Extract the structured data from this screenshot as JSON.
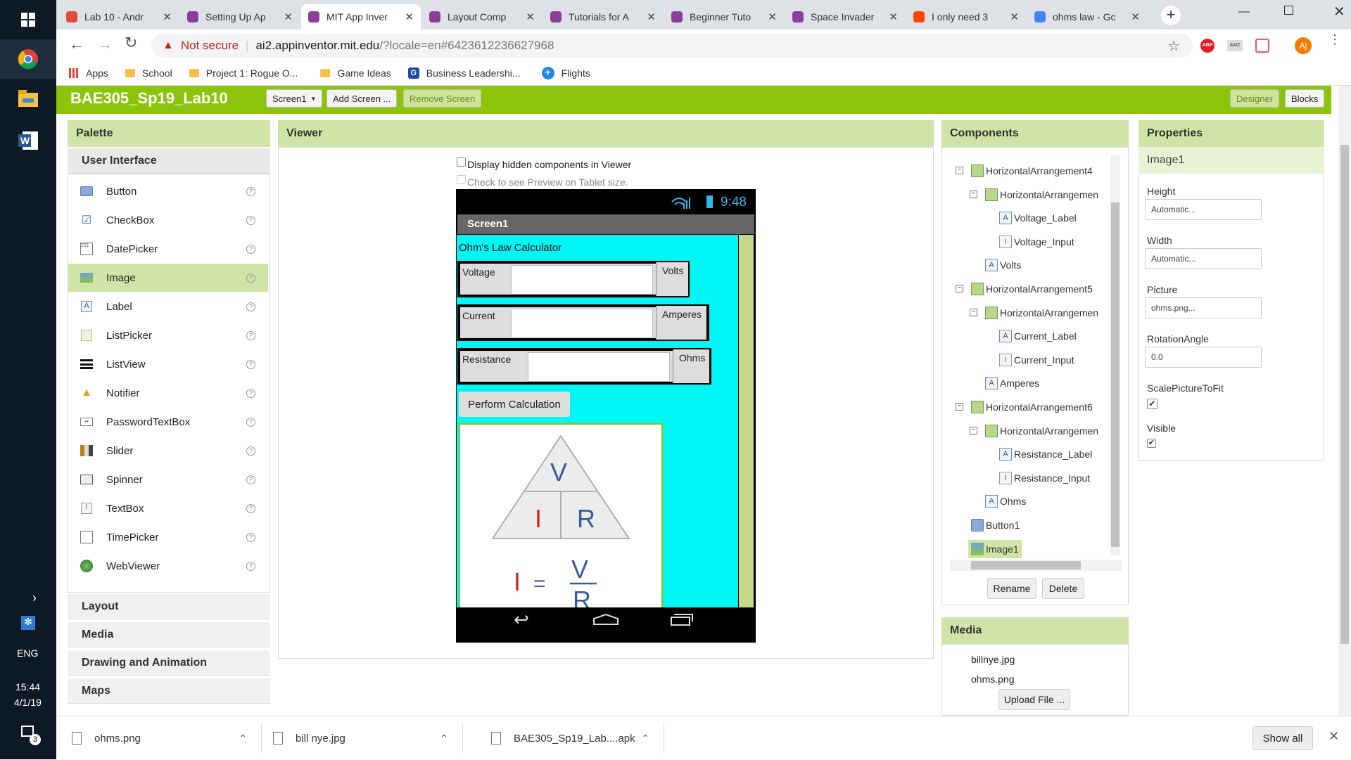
{
  "taskbar": {
    "lang": "ENG",
    "time": "15:44",
    "date": "4/1/19",
    "notif_count": "3"
  },
  "browser": {
    "tabs": [
      {
        "title": "Lab 10 - Andr",
        "color": "#e34a3a"
      },
      {
        "title": "Setting Up Ap",
        "color": "#8c3f9a"
      },
      {
        "title": "MIT App Inver",
        "color": "#8c3f9a",
        "active": true
      },
      {
        "title": "Layout Comp",
        "color": "#8c3f9a"
      },
      {
        "title": "Tutorials for A",
        "color": "#8c3f9a"
      },
      {
        "title": "Beginner Tuto",
        "color": "#8c3f9a"
      },
      {
        "title": "Space Invader",
        "color": "#8c3f9a"
      },
      {
        "title": "I only need 3",
        "color": "#ff4500"
      },
      {
        "title": "ohms law - Gc",
        "color": "#4285f4"
      }
    ],
    "security": "Not secure",
    "url_host": "ai2.appinventor.mit.edu",
    "url_rest": "/?locale=en#6423612236627968",
    "profile": "Aj",
    "bookmarks": [
      "Apps",
      "School",
      "Project 1: Rogue O...",
      "Game Ideas",
      "Business Leadershi...",
      "Flights"
    ]
  },
  "app": {
    "project_name": "BAE305_Sp19_Lab10",
    "screen_dropdown": "Screen1",
    "add_screen": "Add Screen ...",
    "remove_screen": "Remove Screen",
    "designer": "Designer",
    "blocks": "Blocks"
  },
  "palette": {
    "header": "Palette",
    "category_ui": "User Interface",
    "items": [
      "Button",
      "CheckBox",
      "DatePicker",
      "Image",
      "Label",
      "ListPicker",
      "ListView",
      "Notifier",
      "PasswordTextBox",
      "Slider",
      "Spinner",
      "TextBox",
      "TimePicker",
      "WebViewer"
    ],
    "selected": "Image",
    "categories": [
      "Layout",
      "Media",
      "Drawing and Animation",
      "Maps"
    ],
    "help": "?"
  },
  "viewer": {
    "header": "Viewer",
    "display_hidden": "Display hidden components in Viewer",
    "tablet_preview": "Check to see Preview on Tablet size.",
    "phone_time": "9:48",
    "screen_title": "Screen1",
    "app_title": "Ohm's Law Calculator",
    "rows": [
      {
        "label": "Voltage",
        "unit": "Volts"
      },
      {
        "label": "Current",
        "unit": "Amperes"
      },
      {
        "label": "Resistance",
        "unit": "Ohms"
      }
    ],
    "button": "Perform Calculation",
    "triangle": {
      "v": "V",
      "i": "I",
      "r": "R",
      "eq": "="
    }
  },
  "components": {
    "header": "Components",
    "tree": [
      {
        "name": "HorizontalArrangement4",
        "level": 0,
        "icon": "ha",
        "toggle": "-"
      },
      {
        "name": "HorizontalArrangemen",
        "level": 1,
        "icon": "ha",
        "toggle": "-"
      },
      {
        "name": "Voltage_Label",
        "level": 2,
        "icon": "lb"
      },
      {
        "name": "Voltage_Input",
        "level": 2,
        "icon": "tx"
      },
      {
        "name": "Volts",
        "level": 1,
        "icon": "lb"
      },
      {
        "name": "HorizontalArrangement5",
        "level": 0,
        "icon": "ha",
        "toggle": "-"
      },
      {
        "name": "HorizontalArrangemen",
        "level": 1,
        "icon": "ha",
        "toggle": "-"
      },
      {
        "name": "Current_Label",
        "level": 2,
        "icon": "lb"
      },
      {
        "name": "Current_Input",
        "level": 2,
        "icon": "tx"
      },
      {
        "name": "Amperes",
        "level": 1,
        "icon": "lb"
      },
      {
        "name": "HorizontalArrangement6",
        "level": 0,
        "icon": "ha",
        "toggle": "-"
      },
      {
        "name": "HorizontalArrangemen",
        "level": 1,
        "icon": "ha",
        "toggle": "-"
      },
      {
        "name": "Resistance_Label",
        "level": 2,
        "icon": "lb"
      },
      {
        "name": "Resistance_Input",
        "level": 2,
        "icon": "tx"
      },
      {
        "name": "Ohms",
        "level": 1,
        "icon": "lb"
      },
      {
        "name": "Button1",
        "level": 0,
        "icon": "btn"
      },
      {
        "name": "Image1",
        "level": 0,
        "icon": "img",
        "selected": true
      }
    ],
    "rename": "Rename",
    "delete": "Delete"
  },
  "media": {
    "header": "Media",
    "files": [
      "billnye.jpg",
      "ohms.png"
    ],
    "upload": "Upload File ..."
  },
  "properties": {
    "header": "Properties",
    "component": "Image1",
    "height_label": "Height",
    "height": "Automatic...",
    "width_label": "Width",
    "width": "Automatic...",
    "picture_label": "Picture",
    "picture": "ohms.png...",
    "rotation_label": "RotationAngle",
    "rotation": "0.0",
    "scale_label": "ScalePictureToFit",
    "scale_checked": true,
    "visible_label": "Visible",
    "visible_checked": true
  },
  "downloads": {
    "files": [
      "ohms.png",
      "bill nye.jpg",
      "BAE305_Sp19_Lab....apk"
    ],
    "show_all": "Show all"
  }
}
